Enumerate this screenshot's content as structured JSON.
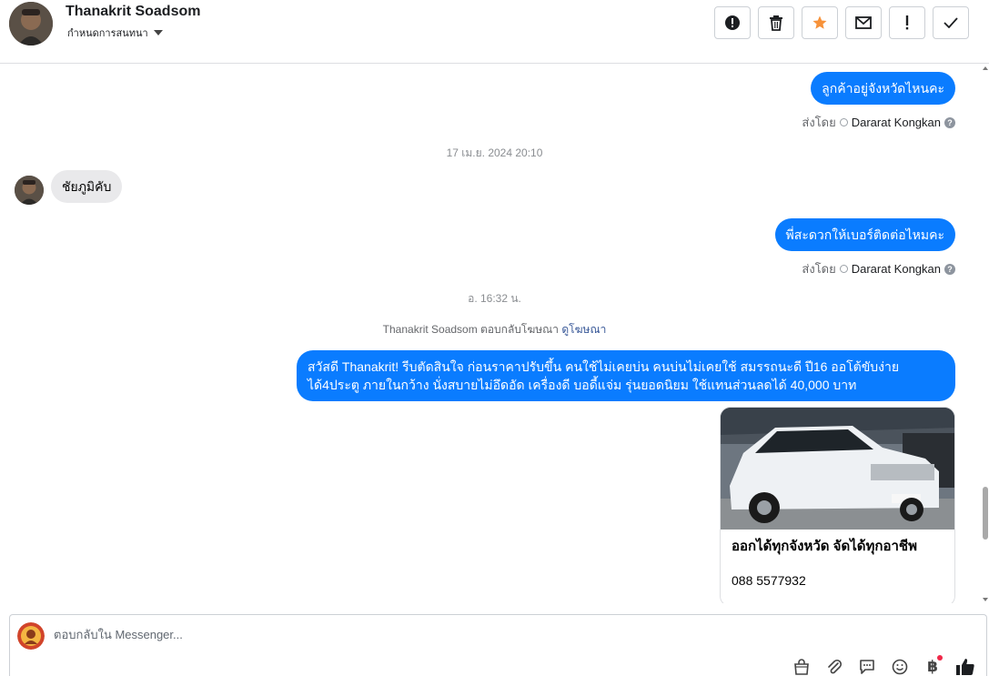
{
  "header": {
    "contact_name": "Thanakrit Soadsom",
    "assign_label": "กำหนดการสนทนา",
    "actions": [
      "spam-icon",
      "trash-icon",
      "star-icon",
      "mail-icon",
      "important-icon",
      "check-icon"
    ]
  },
  "messages": {
    "m1": {
      "text": "ลูกค้าอยู่จังหวัดไหนคะ",
      "sent_by_label": "ส่งโดย",
      "sender": "Dararat Kongkan"
    },
    "ts1": "17 เม.ย. 2024 20:10",
    "m2": {
      "text": "ชัยภูมิคับ"
    },
    "m3": {
      "text": "พี่สะดวกให้เบอร์ติดต่อไหมคะ",
      "sent_by_label": "ส่งโดย",
      "sender": "Dararat Kongkan"
    },
    "ts2": "อ. 16:32 น.",
    "ad_reply": {
      "text": "Thanakrit Soadsom ตอบกลับโฆษณา",
      "link": "ดูโฆษณา"
    },
    "m4": {
      "line1": "สวัสดี Thanakrit! รีบตัดสินใจ ก่อนราคาปรับขึ้น คนใช้ไม่เคยบ่น คนบ่นไม่เคยใช้ สมรรถนะดี ปี16 ออโต้ขับง่าย",
      "line2": "ได้4ประตู ภายในกว้าง นั่งสบายไม่อึดอัด เครื่องดี บอดี้แจ่ม รุ่นยอดนิยม  ใช้แทนส่วนลดได้ 40,000 บาท"
    },
    "card": {
      "title": "ออกได้ทุกจังหวัด จัดได้ทุกอาชีพ",
      "phone": "088 5577932"
    }
  },
  "composer": {
    "placeholder": "ตอบกลับใน Messenger...",
    "tools": [
      "shop-bag-icon",
      "attachment-icon",
      "saved-replies-icon",
      "emoji-icon",
      "baht-icon",
      "like-icon"
    ],
    "baht_symbol": "฿"
  },
  "colors": {
    "accent": "#0a7cff",
    "incoming": "#e9e9eb",
    "star": "#f7923a"
  }
}
